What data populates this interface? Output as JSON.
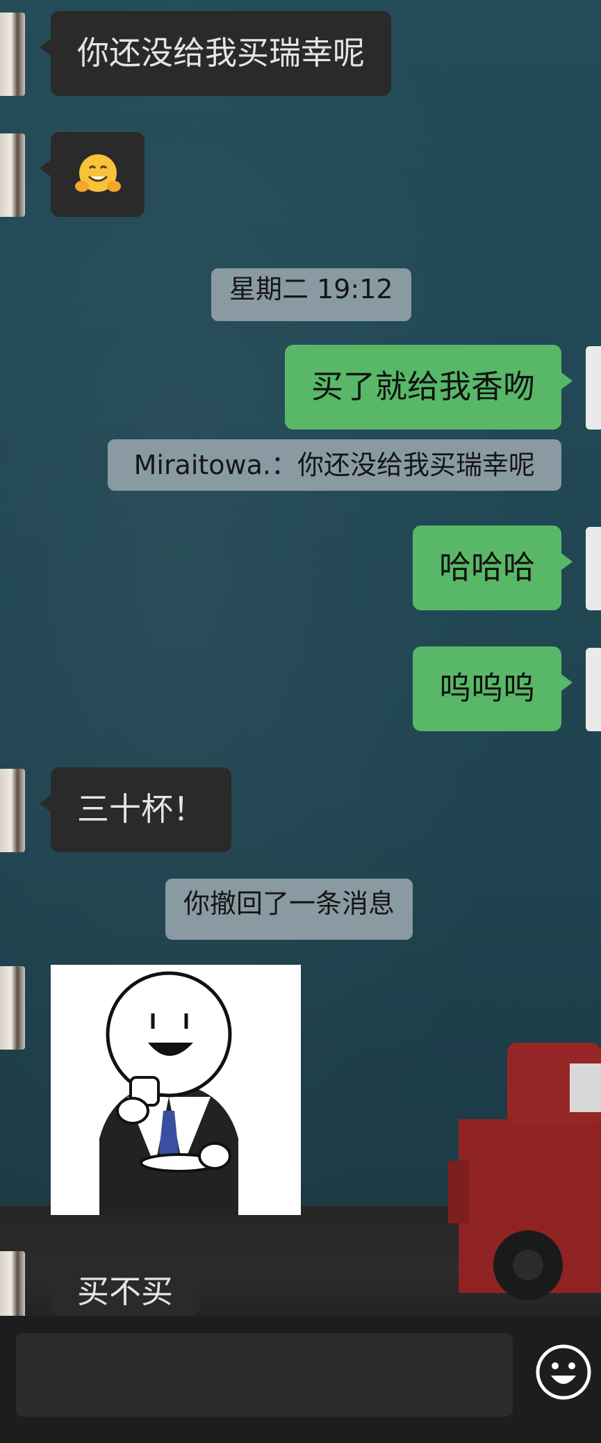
{
  "chat": {
    "messages": [
      {
        "side": "in",
        "type": "text",
        "text": "你还没给我买瑞幸呢"
      },
      {
        "side": "in",
        "type": "emoji",
        "icon": "hugging-face-emoji"
      },
      {
        "type": "timestamp",
        "text": "星期二 19:12"
      },
      {
        "side": "out",
        "type": "text",
        "text": "买了就给我香吻"
      },
      {
        "type": "quote",
        "text": "Miraitowa.：你还没给我买瑞幸呢"
      },
      {
        "side": "out",
        "type": "text",
        "text": "哈哈哈"
      },
      {
        "side": "out",
        "type": "text",
        "text": "呜呜呜"
      },
      {
        "side": "in",
        "type": "text",
        "text": "三十杯！"
      },
      {
        "type": "system",
        "text": "你撤回了一条消息"
      },
      {
        "side": "in",
        "type": "sticker",
        "icon": "man-in-suit-drinking-coffee-sticker"
      },
      {
        "side": "in",
        "type": "text",
        "text": "买不买"
      }
    ]
  },
  "input": {
    "emoji_button_icon": "smiley-face-icon"
  },
  "colors": {
    "outgoing_bubble": "#58b867",
    "incoming_bubble": "#2a2a2a",
    "system_label": "#8a9aa2",
    "background": "#1f4651"
  }
}
